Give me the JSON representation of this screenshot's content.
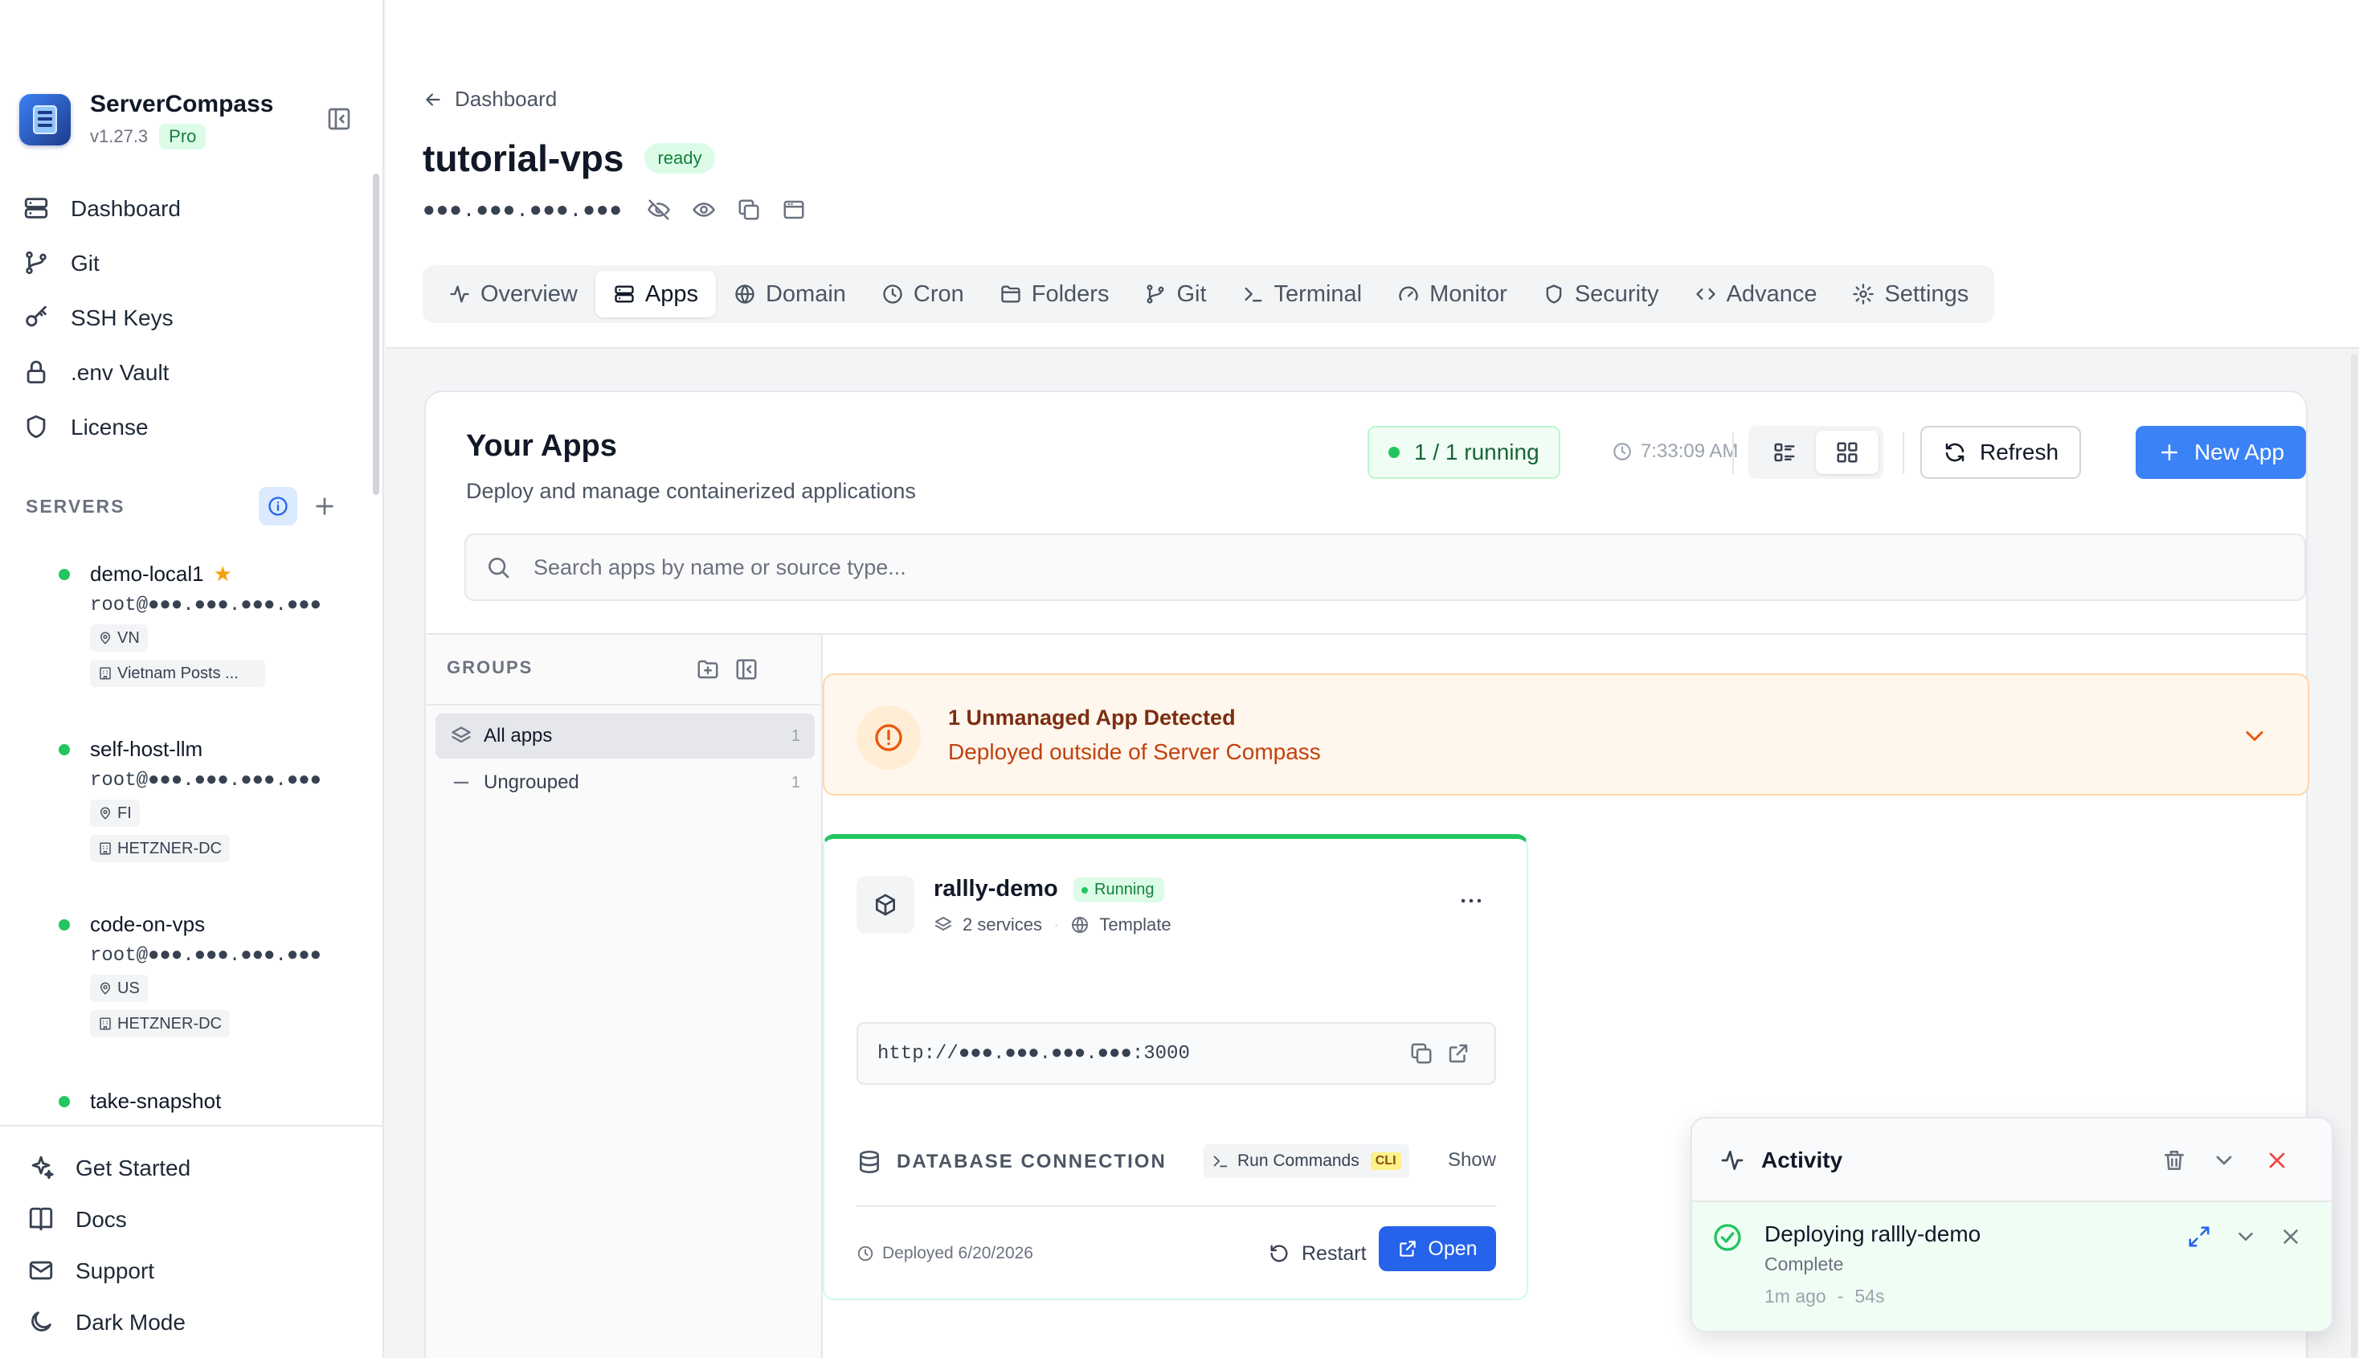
{
  "sidebar": {
    "brand": {
      "name": "ServerCompass",
      "version": "v1.27.3",
      "tier": "Pro"
    },
    "nav": [
      {
        "label": "Dashboard",
        "icon": "server-stack-icon"
      },
      {
        "label": "Git",
        "icon": "git-branch-icon"
      },
      {
        "label": "SSH Keys",
        "icon": "key-icon"
      },
      {
        "label": ".env Vault",
        "icon": "lock-icon"
      },
      {
        "label": "License",
        "icon": "shield-icon"
      }
    ],
    "servers_title": "SERVERS",
    "servers": [
      {
        "name": "demo-local1",
        "favorite": true,
        "host": "root@●●●.●●●.●●●.●●●",
        "region": "VN",
        "provider": "Vietnam Posts ..."
      },
      {
        "name": "self-host-llm",
        "favorite": false,
        "host": "root@●●●.●●●.●●●.●●●",
        "region": "FI",
        "provider": "HETZNER-DC"
      },
      {
        "name": "code-on-vps",
        "favorite": false,
        "host": "root@●●●.●●●.●●●.●●●",
        "region": "US",
        "provider": "HETZNER-DC"
      },
      {
        "name": "take-snapshot",
        "favorite": false
      }
    ],
    "bottom_nav": [
      {
        "label": "Get Started",
        "icon": "sparkles-icon"
      },
      {
        "label": "Docs",
        "icon": "book-icon"
      },
      {
        "label": "Support",
        "icon": "mail-icon"
      },
      {
        "label": "Dark Mode",
        "icon": "moon-icon"
      }
    ]
  },
  "header": {
    "breadcrumb": "Dashboard",
    "title": "tutorial-vps",
    "status": "ready",
    "ip_masked": "●●●.●●●.●●●.●●●",
    "tabs": [
      {
        "label": "Overview",
        "icon": "activity-icon",
        "active": false
      },
      {
        "label": "Apps",
        "icon": "server-stack-icon",
        "active": true
      },
      {
        "label": "Domain",
        "icon": "globe-icon",
        "active": false
      },
      {
        "label": "Cron",
        "icon": "clock-icon",
        "active": false
      },
      {
        "label": "Folders",
        "icon": "folder-icon",
        "active": false
      },
      {
        "label": "Git",
        "icon": "git-branch-icon",
        "active": false
      },
      {
        "label": "Terminal",
        "icon": "terminal-icon",
        "active": false
      },
      {
        "label": "Monitor",
        "icon": "gauge-icon",
        "active": false
      },
      {
        "label": "Security",
        "icon": "shield-icon",
        "active": false
      },
      {
        "label": "Advance",
        "icon": "code-icon",
        "active": false
      },
      {
        "label": "Settings",
        "icon": "gear-icon",
        "active": false
      }
    ]
  },
  "apps": {
    "title": "Your Apps",
    "subtitle": "Deploy and manage containerized applications",
    "running": "1 / 1 running",
    "last_refresh": "7:33:09 AM",
    "view_mode": "grid",
    "refresh_label": "Refresh",
    "new_app_label": "New App",
    "search_placeholder": "Search apps by name or source type...",
    "groups": {
      "title": "GROUPS",
      "items": [
        {
          "label": "All apps",
          "count": "1",
          "active": true
        },
        {
          "label": "Ungrouped",
          "count": "1",
          "active": false
        }
      ]
    },
    "unmanaged": {
      "title": "1 Unmanaged App Detected",
      "subtitle": "Deployed outside of Server Compass"
    },
    "cards": [
      {
        "name": "rallly-demo",
        "status": "Running",
        "services": "2 services",
        "source": "Template",
        "url": "http://●●●.●●●.●●●.●●●:3000",
        "db_label": "DATABASE CONNECTION",
        "run_commands": "Run Commands",
        "cli_tag": "CLI",
        "show_label": "Show",
        "deployed": "Deployed 6/20/2026",
        "restart_label": "Restart",
        "open_label": "Open"
      }
    ]
  },
  "activity": {
    "title": "Activity",
    "items": [
      {
        "name": "Deploying rallly-demo",
        "status": "Complete",
        "time": "1m ago",
        "sep": "-",
        "duration": "54s"
      }
    ]
  },
  "colors": {
    "accent": "#3b82f6",
    "success": "#22c55e",
    "warning": "#ea580c"
  }
}
